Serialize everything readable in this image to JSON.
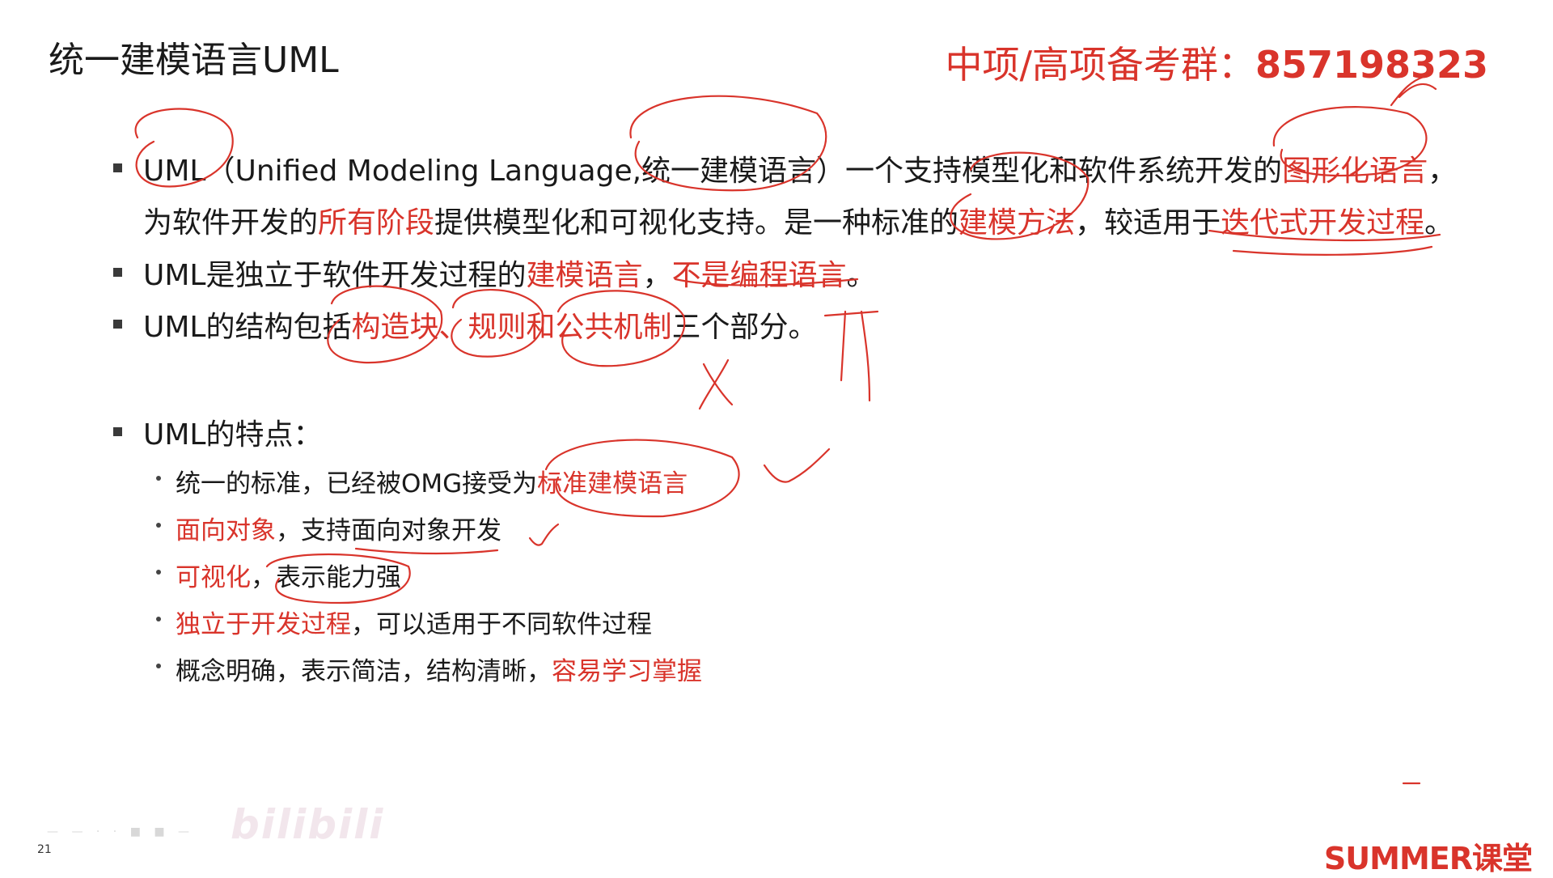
{
  "slide": {
    "title": "统一建模语言UML",
    "group_label": "中项/高项备考群：",
    "group_number": "857198323",
    "page_number": "21",
    "watermark": "bilibili",
    "logo_en": "SUMMER",
    "logo_cn": "课堂"
  },
  "bullets": [
    {
      "line1": [
        {
          "text": "UML（Unified Modeling Language,统一建模语言）一个支持模型化和软件系统开发的",
          "red": false
        },
        {
          "text": "图形化语言",
          "red": true
        },
        {
          "text": "，",
          "red": false
        }
      ],
      "line2": [
        {
          "text": "为软件开发的",
          "red": false
        },
        {
          "text": "所有阶段",
          "red": true
        },
        {
          "text": "提供模型化和可视化支持。是一种标准的",
          "red": false
        },
        {
          "text": "建模方法",
          "red": true
        },
        {
          "text": "，较适用于",
          "red": false
        },
        {
          "text": "迭代式开发过程",
          "red": true
        },
        {
          "text": "。",
          "red": false
        }
      ]
    },
    {
      "line1": [
        {
          "text": "UML是独立于软件开发过程的",
          "red": false
        },
        {
          "text": "建模语言",
          "red": true
        },
        {
          "text": "，",
          "red": false
        },
        {
          "text": "不是编程语言",
          "red": true
        },
        {
          "text": "。",
          "red": false
        }
      ]
    },
    {
      "line1": [
        {
          "text": "UML的结构包括",
          "red": false
        },
        {
          "text": "构造块、规则和公共机制",
          "red": true
        },
        {
          "text": "三个部分。",
          "red": false
        }
      ]
    },
    {
      "line1": [
        {
          "text": "UML的特点：",
          "red": false
        }
      ]
    }
  ],
  "features": [
    [
      {
        "text": "统一的标准，已经被OMG接受为",
        "red": false
      },
      {
        "text": "标准建模语言",
        "red": true
      }
    ],
    [
      {
        "text": "面向对象",
        "red": true
      },
      {
        "text": "，支持面向对象开发",
        "red": false
      }
    ],
    [
      {
        "text": "可视化",
        "red": true
      },
      {
        "text": "，表示能力强",
        "red": false
      }
    ],
    [
      {
        "text": "独立于开发过程",
        "red": true
      },
      {
        "text": "，可以适用于不同软件过程",
        "red": false
      }
    ],
    [
      {
        "text": "概念明确，表示简洁，结构清晰，",
        "red": false
      },
      {
        "text": "容易学习掌握",
        "red": true
      }
    ]
  ]
}
